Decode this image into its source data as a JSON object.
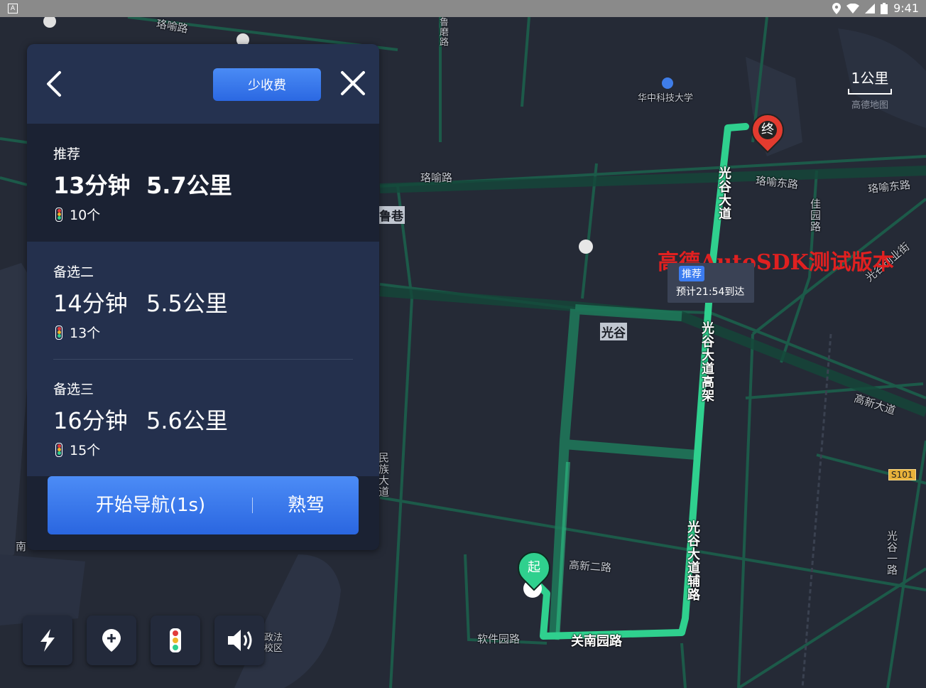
{
  "status_bar": {
    "time": "9:41"
  },
  "map": {
    "labels": {
      "road_top_left": "珞喻路",
      "road_mid": "珞喻路",
      "road_east_1": "珞喻东路",
      "road_east_2": "珞喻东路",
      "huake": "华中科技大学",
      "guanggu_avenue": "光谷大道",
      "guanggu_viaduct": "光谷大道高架",
      "guanggu_service": "光谷大道辅路",
      "guanggu": "光谷",
      "gaoxin_road": "高新大道",
      "gaoxin2": "高新二路",
      "guannan": "关南园路",
      "ruanjian": "软件园路",
      "chuangye": "光谷创业街",
      "jiayuan": "佳园路",
      "minzu": "民族大道",
      "luxiang": "鲁巷",
      "gaoxin_vert": "光谷一路",
      "s101": "S101",
      "school": "政法\n校区",
      "nan": "南",
      "north_road": "鲁磨路"
    },
    "scale": {
      "value": "1公里",
      "brand": "高德地图"
    },
    "watermark": "高德AutoSDK测试版本",
    "route_tag": {
      "tag": "推荐",
      "eta": "预计21:54到达"
    },
    "start_marker": "起",
    "end_marker": "终"
  },
  "panel": {
    "toll_button": "少收费",
    "routes": [
      {
        "label": "推荐",
        "time": "13分钟",
        "distance": "5.7公里",
        "lights": "10个"
      },
      {
        "label": "备选二",
        "time": "14分钟",
        "distance": "5.5公里",
        "lights": "13个"
      },
      {
        "label": "备选三",
        "time": "16分钟",
        "distance": "5.6公里",
        "lights": "15个"
      }
    ],
    "start_nav": "开始导航(1s)",
    "familiar": "熟驾"
  },
  "toolbar": [
    "lightning-icon",
    "add-location-icon",
    "traffic-light-icon",
    "volume-icon"
  ],
  "colors": {
    "route": "#2fd08e",
    "accent": "#3a7bf0",
    "panel_bg": "#1b2233"
  }
}
